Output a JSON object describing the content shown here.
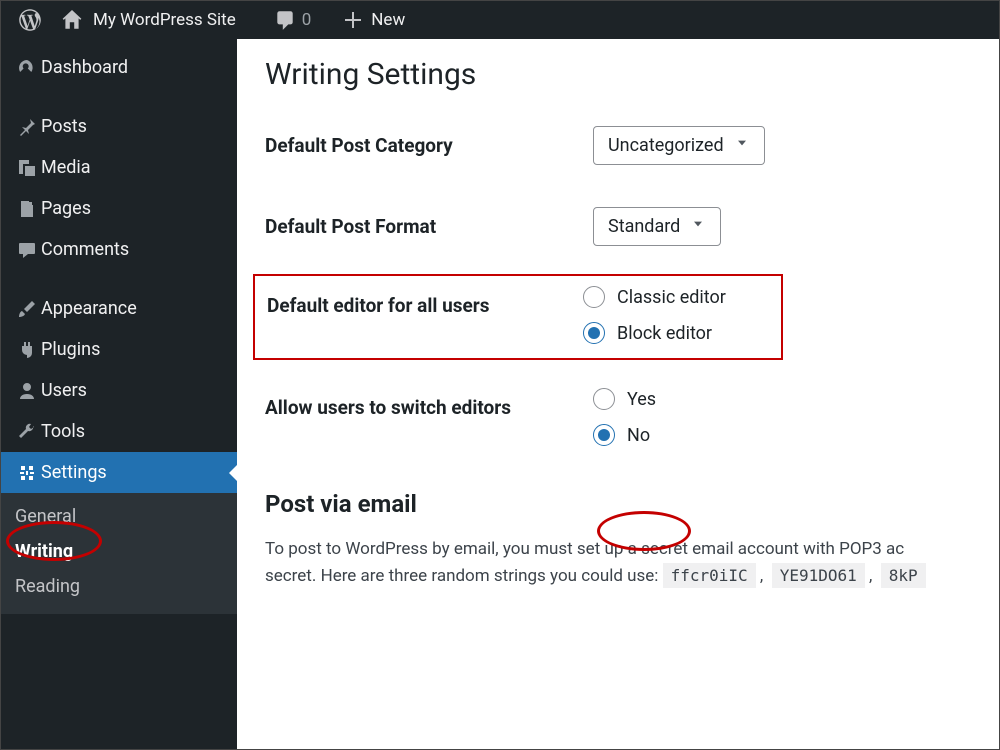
{
  "topbar": {
    "site_name": "My WordPress Site",
    "comment_count": "0",
    "new_label": "New"
  },
  "sidebar": {
    "dashboard": "Dashboard",
    "posts": "Posts",
    "media": "Media",
    "pages": "Pages",
    "comments": "Comments",
    "appearance": "Appearance",
    "plugins": "Plugins",
    "users": "Users",
    "tools": "Tools",
    "settings": "Settings",
    "sub": {
      "general": "General",
      "writing": "Writing",
      "reading": "Reading"
    }
  },
  "page": {
    "title": "Writing Settings",
    "default_category_label": "Default Post Category",
    "default_category_value": "Uncategorized",
    "default_format_label": "Default Post Format",
    "default_format_value": "Standard",
    "default_editor_label": "Default editor for all users",
    "editor_classic": "Classic editor",
    "editor_block": "Block editor",
    "switch_label": "Allow users to switch editors",
    "switch_yes": "Yes",
    "switch_no": "No",
    "post_email_heading": "Post via email",
    "post_email_desc_a": "To post to WordPress by email, you must set up a secret email account with POP3 ac",
    "post_email_desc_b": "secret. Here are three random strings you could use: ",
    "code1": "ffcr0iIC",
    "code2": "YE91DO61",
    "code3": "8kP"
  }
}
